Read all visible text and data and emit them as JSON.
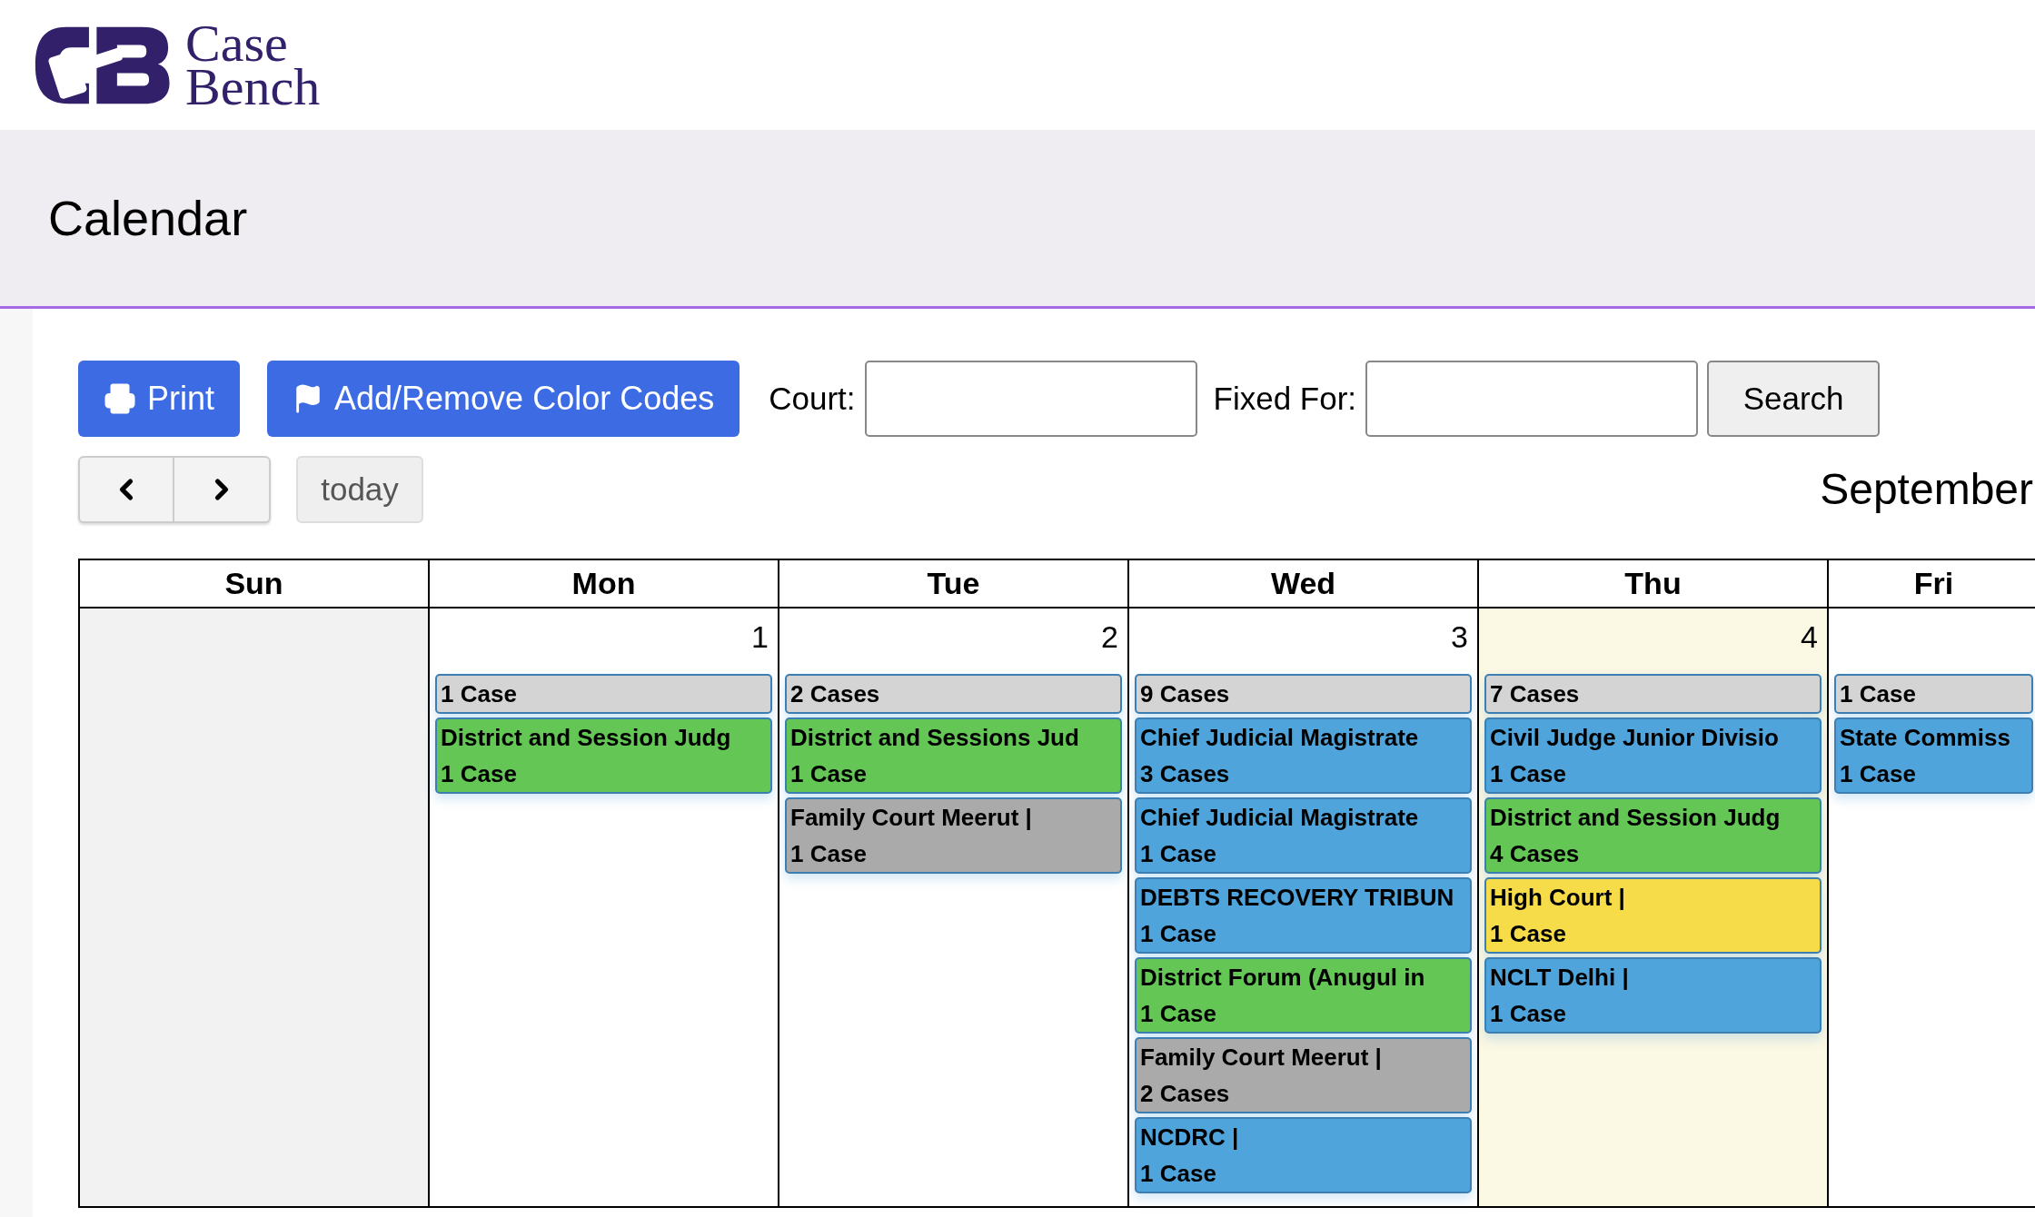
{
  "logo": {
    "line_1": "Case",
    "line_2": "Bench"
  },
  "page_title": "Calendar",
  "toolbar": {
    "print_button": "Print",
    "color_codes_button": "Add/Remove Color Codes",
    "court_label": "Court:",
    "fixed_for_label": "Fixed For:",
    "search_button": "Search"
  },
  "navigation": {
    "today_button": "today",
    "month_title": "September"
  },
  "days": [
    {
      "header": "Sun",
      "shaded": true,
      "today": false
    },
    {
      "header": "Mon",
      "date": "1",
      "shaded": false,
      "today": false,
      "events": [
        {
          "kind": "summary",
          "title": "1 Case",
          "color": "#d4d4d4"
        },
        {
          "kind": "court",
          "title": "District and Session Judg",
          "count": "1 Case",
          "color": "#63c655"
        }
      ]
    },
    {
      "header": "Tue",
      "date": "2",
      "shaded": false,
      "today": false,
      "events": [
        {
          "kind": "summary",
          "title": "2 Cases",
          "color": "#d4d4d4"
        },
        {
          "kind": "court",
          "title": "District and Sessions Jud",
          "count": "1 Case",
          "color": "#63c655"
        },
        {
          "kind": "court",
          "title": "Family Court Meerut |",
          "count": "1 Case",
          "color": "#aaaaaa"
        }
      ]
    },
    {
      "header": "Wed",
      "date": "3",
      "shaded": false,
      "today": false,
      "events": [
        {
          "kind": "summary",
          "title": "9 Cases",
          "color": "#d4d4d4"
        },
        {
          "kind": "court",
          "title": "Chief Judicial Magistrate",
          "count": "3 Cases",
          "color": "#4fa4db"
        },
        {
          "kind": "court",
          "title": "Chief Judicial Magistrate",
          "count": "1 Case",
          "color": "#4fa4db"
        },
        {
          "kind": "court",
          "title": "DEBTS RECOVERY TRIBUN",
          "count": "1 Case",
          "color": "#4fa4db"
        },
        {
          "kind": "court",
          "title": "District Forum (Anugul in",
          "count": "1 Case",
          "color": "#63c655"
        },
        {
          "kind": "court",
          "title": "Family Court Meerut |",
          "count": "2 Cases",
          "color": "#aaaaaa"
        },
        {
          "kind": "court",
          "title": "NCDRC |",
          "count": "1 Case",
          "color": "#4fa4db"
        }
      ]
    },
    {
      "header": "Thu",
      "date": "4",
      "shaded": false,
      "today": true,
      "events": [
        {
          "kind": "summary",
          "title": "7 Cases",
          "color": "#d4d4d4"
        },
        {
          "kind": "court",
          "title": "Civil Judge Junior Divisio",
          "count": "1 Case",
          "color": "#4fa4db"
        },
        {
          "kind": "court",
          "title": "District and Session Judg",
          "count": "4 Cases",
          "color": "#63c655"
        },
        {
          "kind": "court",
          "title": "High Court |",
          "count": "1 Case",
          "color": "#f7dc4a"
        },
        {
          "kind": "court",
          "title": "NCLT Delhi |",
          "count": "1 Case",
          "color": "#4fa4db"
        }
      ]
    },
    {
      "header": "Fri",
      "shaded": false,
      "today": false,
      "events": [
        {
          "kind": "summary",
          "title": "1 Case",
          "color": "#d4d4d4"
        },
        {
          "kind": "court",
          "title": "State Commiss",
          "count": "1 Case",
          "color": "#4fa4db"
        }
      ]
    }
  ]
}
